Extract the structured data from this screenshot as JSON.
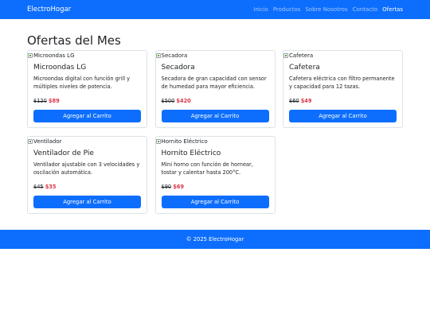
{
  "brand": "ElectroHogar",
  "nav": [
    "Inicio",
    "Productos",
    "Sobre Nosotros",
    "Contacto",
    "Ofertas"
  ],
  "active_nav": "Ofertas",
  "page_title": "Ofertas del Mes",
  "button_label": "Agregar al Carrito",
  "products": [
    {
      "image_alt": "Microondas LG",
      "name": "Microondas LG",
      "description": "Microondas digital con función grill y múltiples niveles de potencia.",
      "old_price": "$120",
      "new_price": "$89"
    },
    {
      "image_alt": "Secadora",
      "name": "Secadora",
      "description": "Secadora de gran capacidad con sensor de humedad para mayor eficiencia.",
      "old_price": "$500",
      "new_price": "$420"
    },
    {
      "image_alt": "Cafetera",
      "name": "Cafetera",
      "description": "Cafetera eléctrica con filtro permanente y capacidad para 12 tazas.",
      "old_price": "$60",
      "new_price": "$49"
    },
    {
      "image_alt": "Ventilador",
      "name": "Ventilador de Pie",
      "description": "Ventilador ajustable con 3 velocidades y oscilación automática.",
      "old_price": "$45",
      "new_price": "$35"
    },
    {
      "image_alt": "Hornito Eléctrico",
      "name": "Hornito Eléctrico",
      "description": "Mini horno con función de hornear, tostar y calentar hasta 200°C.",
      "old_price": "$90",
      "new_price": "$69"
    }
  ],
  "footer": "© 2025 ElectroHogar",
  "colors": {
    "primary": "#0d6efd",
    "sale": "#dc3545"
  }
}
